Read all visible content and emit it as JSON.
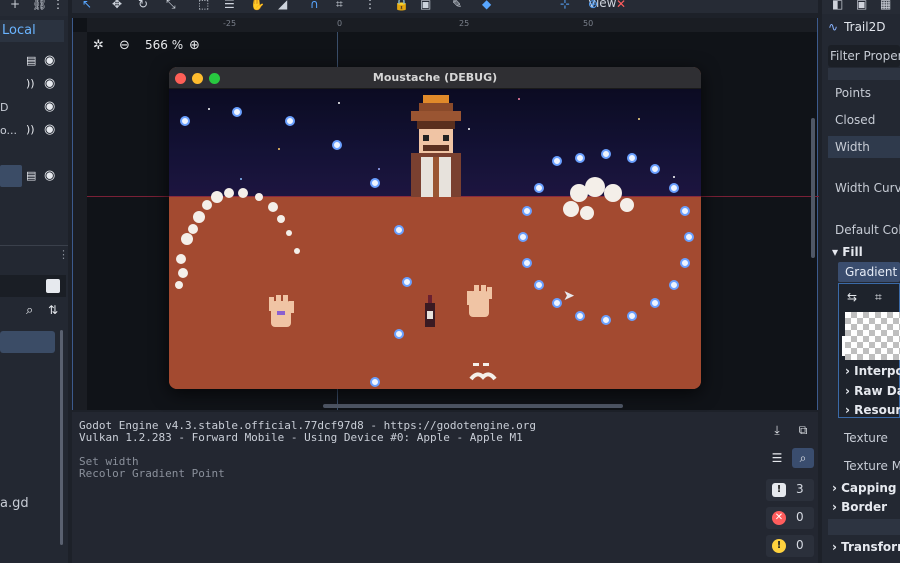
{
  "toolbar": {
    "view_label": "View"
  },
  "scene_dock": {
    "local_tab": "Local",
    "rows": [
      {
        "label": "",
        "icon": "script-icon"
      },
      {
        "label": "",
        "icon": "signal-icon"
      },
      {
        "label": "D",
        "icon": ""
      },
      {
        "label": "o...",
        "icon": "signal-icon"
      }
    ],
    "file": "a.gd"
  },
  "viewport": {
    "zoom": "566 %",
    "ruler_ticks": [
      "-25",
      "0",
      "25",
      "50"
    ]
  },
  "game_window": {
    "title": "Moustache (DEBUG)"
  },
  "output": {
    "lines": [
      "Godot Engine v4.3.stable.official.77dcf97d8 - https://godotengine.org",
      "Vulkan 1.2.283 - Forward Mobile - Using Device #0: Apple - Apple M1",
      "",
      "Set width",
      "Recolor Gradient Point"
    ],
    "counts": {
      "messages": "3",
      "errors": "0",
      "warnings": "0"
    }
  },
  "inspector": {
    "node_name": "Trail2D",
    "filter_placeholder": "Filter Properties",
    "props": {
      "points": "Points",
      "closed": "Closed",
      "width": "Width",
      "width_curve": "Width Curve",
      "default_color": "Default Color"
    },
    "fill_section": "Fill",
    "gradient_tab": "Gradient",
    "gradient_subs": [
      "Interpolation",
      "Raw Data",
      "Resource"
    ],
    "texture": "Texture",
    "texture_mode": "Texture Mode",
    "sections": [
      "Capping",
      "Border",
      "Transform"
    ]
  },
  "colors": {
    "accent": "#58a6ff",
    "ground": "#a34a30",
    "sky": "#141236"
  }
}
